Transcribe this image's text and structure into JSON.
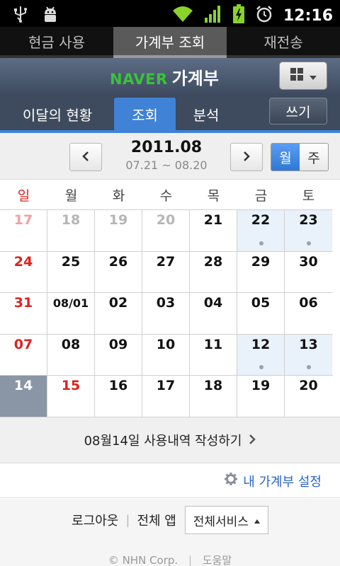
{
  "status": {
    "time": "12:16"
  },
  "app_tabs": [
    {
      "label": "현금 사용",
      "active": false
    },
    {
      "label": "가계부 조회",
      "active": true
    },
    {
      "label": "재전송",
      "active": false
    }
  ],
  "header": {
    "brand": "NAVER",
    "title": "가계부",
    "menu_icon": "grid-icon"
  },
  "sub_tabs": [
    {
      "label": "이달의 현황",
      "active": false
    },
    {
      "label": "조회",
      "active": true
    },
    {
      "label": "분석",
      "active": false
    }
  ],
  "write_button": "쓰기",
  "month_nav": {
    "title": "2011.08",
    "range": "07.21 ~ 08.20",
    "view_month": "월",
    "view_week": "주"
  },
  "weekdays": [
    "일",
    "월",
    "화",
    "수",
    "목",
    "금",
    "토"
  ],
  "weeks": [
    [
      {
        "d": "17",
        "c": "pink"
      },
      {
        "d": "18",
        "c": "gray"
      },
      {
        "d": "19",
        "c": "gray"
      },
      {
        "d": "20",
        "c": "gray"
      },
      {
        "d": "21"
      },
      {
        "d": "22",
        "hl": true,
        "dot": true
      },
      {
        "d": "23",
        "hl": true,
        "dot": true
      }
    ],
    [
      {
        "d": "24",
        "c": "red"
      },
      {
        "d": "25"
      },
      {
        "d": "26"
      },
      {
        "d": "27"
      },
      {
        "d": "28"
      },
      {
        "d": "29"
      },
      {
        "d": "30"
      }
    ],
    [
      {
        "d": "31",
        "c": "red"
      },
      {
        "d": "08/01",
        "small": true
      },
      {
        "d": "02"
      },
      {
        "d": "03"
      },
      {
        "d": "04"
      },
      {
        "d": "05"
      },
      {
        "d": "06"
      }
    ],
    [
      {
        "d": "07",
        "c": "red"
      },
      {
        "d": "08"
      },
      {
        "d": "09"
      },
      {
        "d": "10"
      },
      {
        "d": "11"
      },
      {
        "d": "12",
        "hl": true,
        "dot": true
      },
      {
        "d": "13",
        "hl": true,
        "dot": true
      }
    ],
    [
      {
        "d": "14",
        "today": true
      },
      {
        "d": "15",
        "c": "red"
      },
      {
        "d": "16"
      },
      {
        "d": "17"
      },
      {
        "d": "18"
      },
      {
        "d": "19"
      },
      {
        "d": "20"
      }
    ]
  ],
  "write_day": "08월14일 사용내역 작성하기",
  "settings_link": "내 가계부 설정",
  "footer": {
    "logout": "로그아웃",
    "all_apps": "전체 앱",
    "service_select": "전체서비스",
    "copyright": "© NHN Corp.",
    "help": "도움말"
  }
}
